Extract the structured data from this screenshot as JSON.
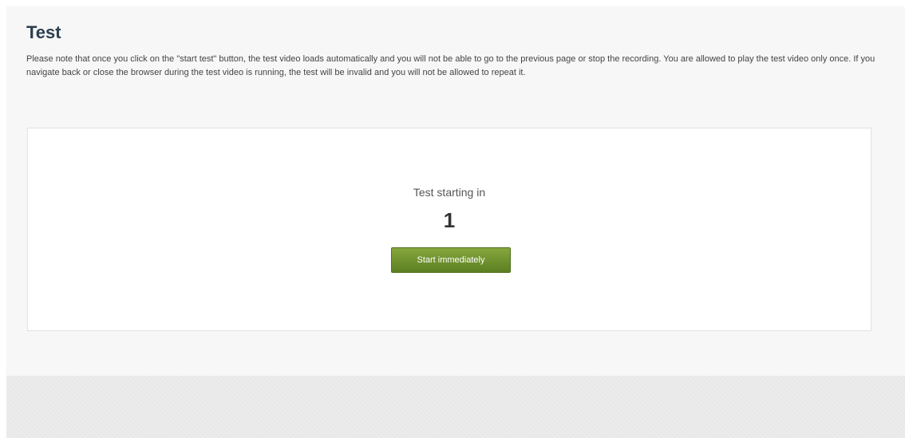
{
  "page": {
    "title": "Test",
    "notice": "Please note that once you click on the \"start test\" button, the test video loads automatically and you will not be able to go to the previous page or stop the recording. You are allowed to play the test video only once. If you navigate back or close the browser during the test video is running, the test will be invalid and you will not be allowed to repeat it."
  },
  "countdown": {
    "label": "Test starting in",
    "value": "1"
  },
  "actions": {
    "start_label": "Start immediately"
  },
  "colors": {
    "button": "#6b8e2b",
    "title": "#2c3e50"
  }
}
